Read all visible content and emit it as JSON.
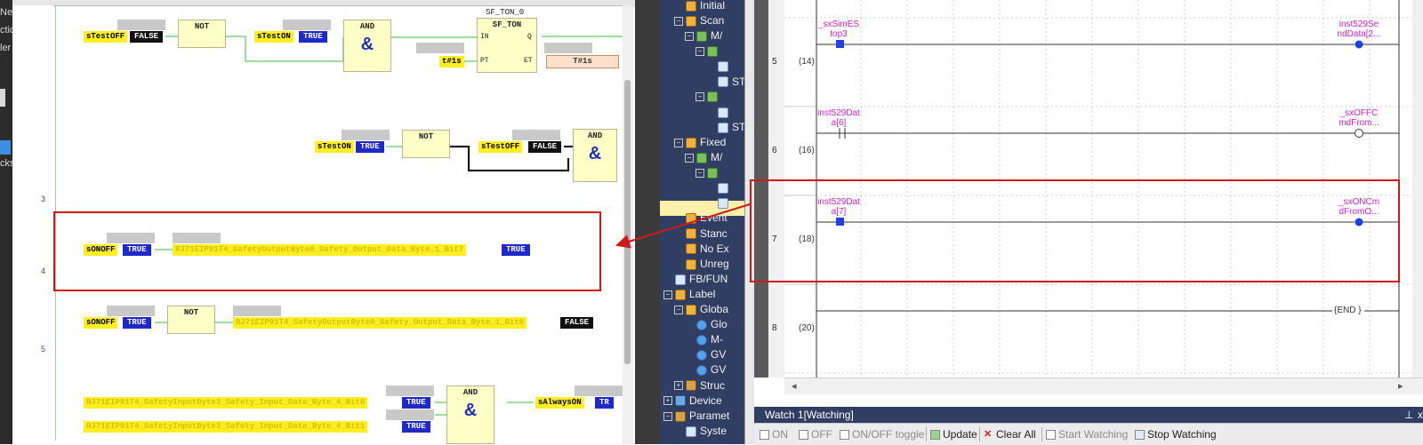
{
  "left_strip": {
    "fragments": [
      "Ne",
      "ctio",
      "ler",
      "cks"
    ]
  },
  "fbd": {
    "line_numbers": [
      "3",
      "4",
      "5"
    ],
    "row1": {
      "in1": "sTestOFF",
      "in1_val": "FALSE",
      "not1": "NOT",
      "in2": "sTestON",
      "in2_val": "TRUE",
      "and1": "AND",
      "and1_sym": "&",
      "timer_instance": "SF_TON_0",
      "timer_type": "SF_TON",
      "pin_in": "IN",
      "pin_q": "Q",
      "pin_pt": "PT",
      "pin_et": "ET",
      "pt_const": "t#1s",
      "et_val": "T#1s"
    },
    "row2": {
      "in1": "sTestON",
      "in1_val": "TRUE",
      "not2": "NOT",
      "in2": "sTestOFF",
      "in2_val": "FALSE",
      "and2": "AND",
      "and2_sym": "&"
    },
    "row3": {
      "in1": "sONOFF",
      "in1_val": "TRUE",
      "out": "RJ71EIP91T4_SafetyOutputByte0_Safety_Output_Data_Byte_1_Bit7",
      "out_val": "TRUE"
    },
    "row4": {
      "in1": "sONOFF",
      "in1_val": "TRUE",
      "not3": "NOT",
      "out": "RJ71EIP91T4_SafetyOutputByte0_Safety_Output_Data_Byte_1_Bit6",
      "out_val": "FALSE"
    },
    "row5": {
      "in1": "RJ71EIP91T4_SafetyInputByte3_Safety_Input_Data_Byte_4_Bit0",
      "in1_val": "TRUE",
      "in2": "RJ71EIP91T4_SafetyInputByte3_Safety_Input_Data_Byte_4_Bit1",
      "in2_val": "TRUE",
      "and3": "AND",
      "and3_sym": "&",
      "out": "sAlwaysON",
      "out_val": "TR"
    }
  },
  "tree": {
    "items": [
      {
        "label": "Initial",
        "icon": "folder-icon",
        "expander": ""
      },
      {
        "label": "Scan",
        "icon": "folder-icon",
        "expander": "−"
      },
      {
        "label": "M/",
        "icon": "program-icon",
        "expander": "−"
      },
      {
        "label": "",
        "icon": "program-block-icon",
        "expander": "−"
      },
      {
        "label": "",
        "icon": "program-doc-icon",
        "expander": ""
      },
      {
        "label": "ST",
        "icon": "program-doc-icon",
        "expander": ""
      },
      {
        "label": "",
        "icon": "program-block-icon",
        "expander": "−"
      },
      {
        "label": "",
        "icon": "program-doc-icon",
        "expander": ""
      },
      {
        "label": "ST",
        "icon": "program-doc-icon",
        "expander": ""
      },
      {
        "label": "Fixed",
        "icon": "folder-icon",
        "expander": "−"
      },
      {
        "label": "M/",
        "icon": "program-icon",
        "expander": "−"
      },
      {
        "label": "",
        "icon": "program-block-icon",
        "expander": "−"
      },
      {
        "label": "",
        "icon": "program-doc-icon",
        "expander": ""
      },
      {
        "label": "",
        "icon": "program-doc-icon",
        "expander": ""
      },
      {
        "label": "Event",
        "icon": "folder-icon",
        "expander": ""
      },
      {
        "label": "Stanc",
        "icon": "folder-icon",
        "expander": ""
      },
      {
        "label": "No Ex",
        "icon": "folder-icon",
        "expander": ""
      },
      {
        "label": "Unreg",
        "icon": "folder-icon",
        "expander": ""
      },
      {
        "label": "FB/FUN",
        "icon": "fbfun-icon",
        "expander": ""
      },
      {
        "label": "Label",
        "icon": "folder-icon",
        "expander": "−"
      },
      {
        "label": "Globa",
        "icon": "folder-icon",
        "expander": "−"
      },
      {
        "label": "Glo",
        "icon": "global-label-icon",
        "expander": ""
      },
      {
        "label": "M-",
        "icon": "global-label-icon",
        "expander": ""
      },
      {
        "label": "GV",
        "icon": "global-label-icon",
        "expander": ""
      },
      {
        "label": "GV",
        "icon": "global-label-icon",
        "expander": ""
      },
      {
        "label": "Struc",
        "icon": "structure-icon",
        "expander": "+"
      },
      {
        "label": "Device",
        "icon": "device-icon",
        "expander": "+"
      },
      {
        "label": "Paramet",
        "icon": "parameter-icon",
        "expander": "−"
      },
      {
        "label": "Syste",
        "icon": "system-icon",
        "expander": ""
      }
    ]
  },
  "ladder": {
    "rungs": [
      {
        "num": "5",
        "step": "(14)",
        "contact": "_sxSimES\ntop3",
        "coil": "inst529Se\nndData[2..."
      },
      {
        "num": "6",
        "step": "(16)",
        "contact": "inst529Dat\na[6]",
        "coil": "_sxOFFC\nmdFrom..."
      },
      {
        "num": "7",
        "step": "(18)",
        "contact": "inst529Dat\na[7]",
        "coil": "_sxONCm\ndFromO..."
      },
      {
        "num": "8",
        "step": "(20)",
        "contact": "",
        "coil": ""
      }
    ],
    "end_label": "{END }"
  },
  "watch": {
    "title": "Watch 1[Watching]",
    "pin_glyph": "⊥",
    "close_glyph": "x",
    "buttons": [
      {
        "label": "ON",
        "enabled": false
      },
      {
        "label": "OFF",
        "enabled": false
      },
      {
        "label": "ON/OFF toggle",
        "enabled": false
      },
      {
        "label": "Update",
        "enabled": true
      },
      {
        "label": "Clear All",
        "enabled": true
      },
      {
        "label": "Start Watching",
        "enabled": false
      },
      {
        "label": "Stop Watching",
        "enabled": true
      }
    ]
  },
  "colors": {
    "var_bg": "#ffee22",
    "true_bg": "#1f29c9",
    "false_bg": "#111111",
    "annotation": "#d01818",
    "tree_bg": "#2f3e62",
    "ladder_label": "#d021c8",
    "and_symbol": "#1c2fb8"
  }
}
